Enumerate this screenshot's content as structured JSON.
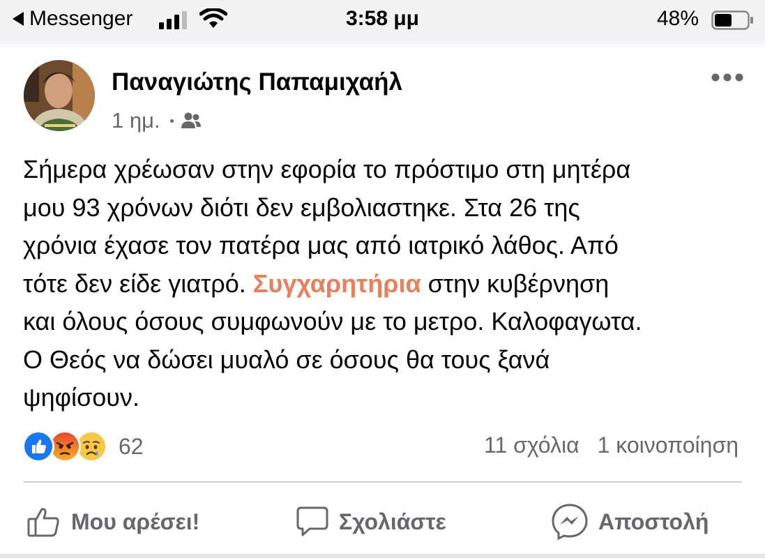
{
  "status_bar": {
    "back_app": "Messenger",
    "time": "3:58 μμ",
    "battery": "48%"
  },
  "post": {
    "author": "Παναγιώτης Παπαμιχαήλ",
    "time": "1 ημ.",
    "audience_icon": "friends-icon",
    "text_lines": [
      {
        "text": "Σήμερα χρέωσαν στην εφορία το πρόστιμο στη μητέρα"
      },
      {
        "text": "μου 93 χρόνων διότι δεν εμβολιαστηκε. Στα 26 της"
      },
      {
        "text": "χρόνια έχασε τον πατέρα μας από ιατρικό λάθος. Από"
      },
      {
        "before": "τότε δεν είδε γιατρό. ",
        "highlight": "Συγχαρητήρια",
        "after": " στην κυβέρνηση"
      },
      {
        "text": "και όλους όσους συμφωνούν με το μετρο. Καλοφαγωτα."
      },
      {
        "text": "Ο Θεός να δώσει μυαλό σε όσους θα τους ξανά"
      },
      {
        "text": "ψηφίσουν."
      }
    ],
    "highlight_color": "#e9805d"
  },
  "stats": {
    "reactions": [
      "like",
      "angry",
      "sad"
    ],
    "reaction_count": "62",
    "comments": "11 σχόλια",
    "shares": "1 κοινοποίηση"
  },
  "actions": {
    "like": "Μου αρέσει!",
    "comment": "Σχολιάστε",
    "send": "Αποστολή"
  }
}
